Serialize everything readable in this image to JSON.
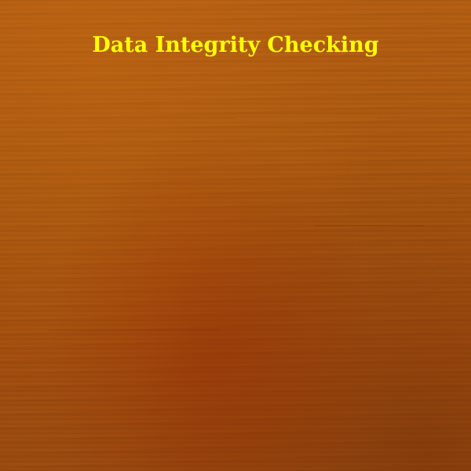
{
  "slide": {
    "title": "Data Integrity Checking",
    "title_color": "#ffff00",
    "background": "wood-texture",
    "background_color": "#a65410"
  }
}
